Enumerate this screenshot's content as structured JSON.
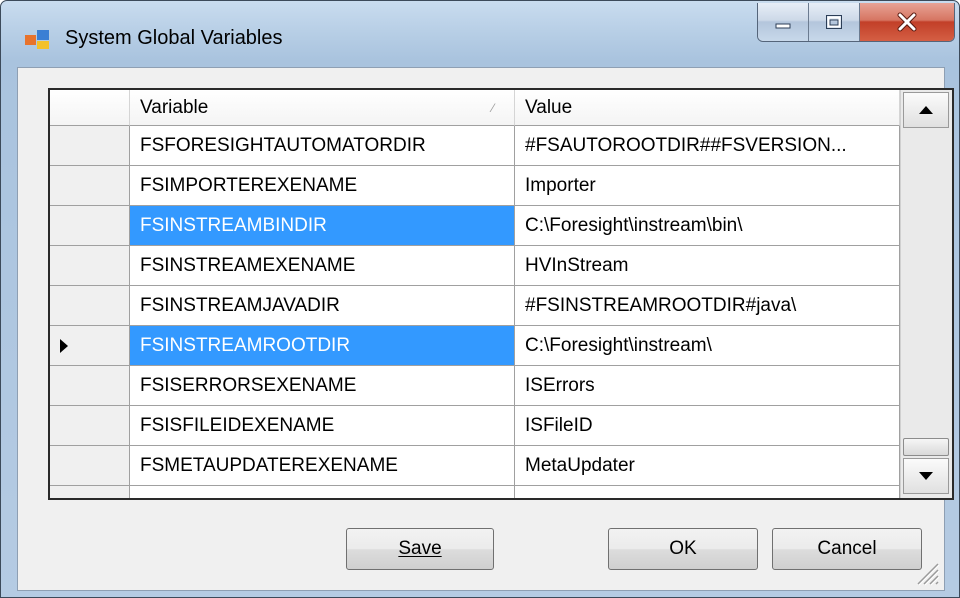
{
  "window": {
    "title": "System Global Variables",
    "icons": {
      "app": "window-app-icon",
      "minimize": "minimize-icon",
      "maximize": "maximize-icon",
      "close": "close-icon"
    }
  },
  "grid": {
    "columns": {
      "variable": "Variable",
      "value": "Value"
    },
    "rows": [
      {
        "variable": "FSFORESIGHTAUTOMATORDIR",
        "value": "#FSAUTOROOTDIR##FSVERSION...",
        "selected": false,
        "current": false
      },
      {
        "variable": "FSIMPORTEREXENAME",
        "value": "Importer",
        "selected": false,
        "current": false
      },
      {
        "variable": "FSINSTREAMBINDIR",
        "value": "C:\\Foresight\\instream\\bin\\",
        "selected": true,
        "current": false
      },
      {
        "variable": "FSINSTREAMEXENAME",
        "value": "HVInStream",
        "selected": false,
        "current": false
      },
      {
        "variable": "FSINSTREAMJAVADIR",
        "value": "#FSINSTREAMROOTDIR#java\\",
        "selected": false,
        "current": false
      },
      {
        "variable": "FSINSTREAMROOTDIR",
        "value": "C:\\Foresight\\instream\\",
        "selected": true,
        "current": true
      },
      {
        "variable": "FSISERRORSEXENAME",
        "value": "ISErrors",
        "selected": false,
        "current": false
      },
      {
        "variable": "FSISFILEIDEXENAME",
        "value": "ISFileID",
        "selected": false,
        "current": false
      },
      {
        "variable": "FSMETAUPDATEREXENAME",
        "value": "MetaUpdater",
        "selected": false,
        "current": false
      }
    ]
  },
  "buttons": {
    "save": "Save",
    "ok": "OK",
    "cancel": "Cancel"
  },
  "colors": {
    "selection": "#3399ff",
    "selection_text": "#ffffff",
    "close_button": "#c23f28"
  }
}
